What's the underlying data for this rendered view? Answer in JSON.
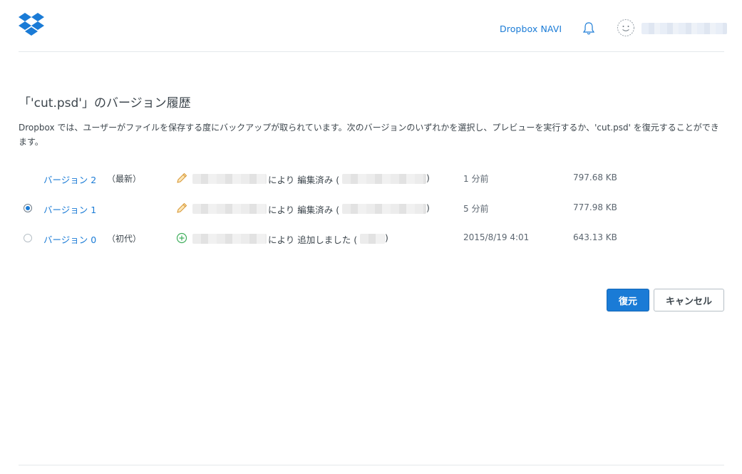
{
  "header": {
    "nav_link": "Dropbox NAVI",
    "icons": {
      "logo": "dropbox-logo-icon",
      "bell": "bell-icon",
      "avatar": "avatar-icon"
    },
    "brand_color": "#1a7bd6"
  },
  "page": {
    "title": "「'cut.psd'」のバージョン履歴",
    "description": "Dropbox では、ユーザーがファイルを保存する度にバックアップが取られています。次のバージョンのいずれかを選択し、プレビューを実行するか、'cut.psd' を復元することができます。"
  },
  "versions": [
    {
      "name": "バージョン 2",
      "tag": "（最新）",
      "action": "により 編集済み (",
      "close": ")",
      "time": "1 分前",
      "size": "797.68 KB",
      "icon": "pencil-icon",
      "selected": null
    },
    {
      "name": "バージョン 1",
      "tag": "",
      "action": "により 編集済み (",
      "close": ")",
      "time": "5 分前",
      "size": "777.98 KB",
      "icon": "pencil-icon",
      "selected": true
    },
    {
      "name": "バージョン 0",
      "tag": "（初代）",
      "action": "により 追加しました (",
      "close": ")",
      "time": "2015/8/19 4:01",
      "size": "643.13 KB",
      "icon": "add-circle-icon",
      "selected": false
    }
  ],
  "buttons": {
    "restore": "復元",
    "cancel": "キャンセル"
  }
}
